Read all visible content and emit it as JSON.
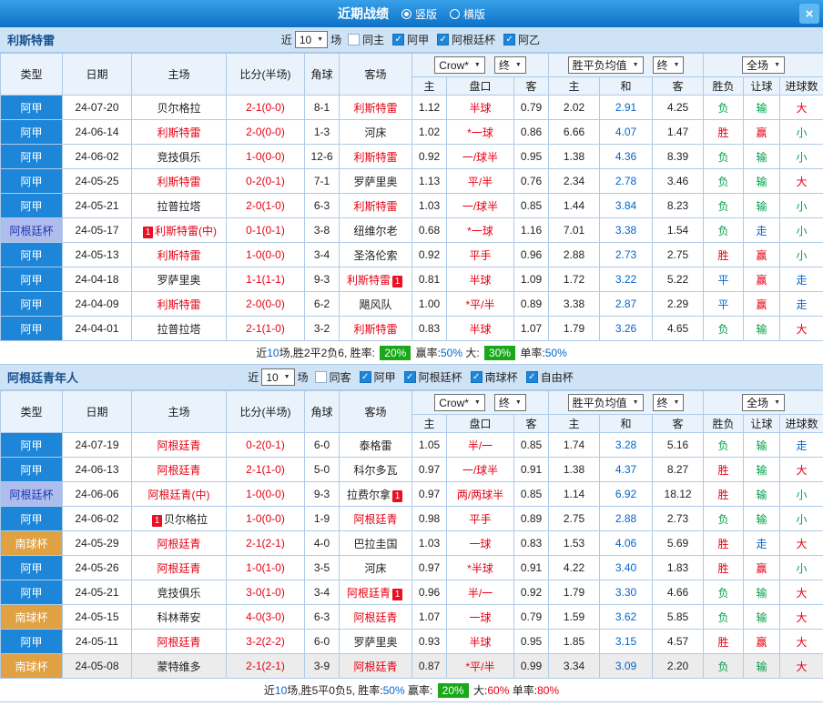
{
  "titlebar": {
    "title": "近期战绩",
    "radio_vertical": "竖版",
    "radio_horizontal": "横版",
    "close": "×"
  },
  "header_cols": {
    "col_type": "类型",
    "col_date": "日期",
    "col_home": "主场",
    "col_score": "比分(半场)",
    "col_corner": "角球",
    "col_away": "客场",
    "sel_bookmaker": "Crow*",
    "sel_final": "终",
    "sel_avg": "胜平负均值",
    "sel_scope": "全场",
    "sub_home": "主",
    "sub_handicap": "盘口",
    "sub_away": "客",
    "sub_home2": "主",
    "sub_draw": "和",
    "sub_away2": "客",
    "sub_result": "胜负",
    "sub_handicap_result": "让球",
    "sub_goals": "进球数"
  },
  "sections": [
    {
      "team": "利斯特雷",
      "filter": {
        "near": "近",
        "count": "10",
        "games": "场",
        "checks": [
          {
            "label": "同主",
            "checked": false
          },
          {
            "label": "阿甲",
            "checked": true
          },
          {
            "label": "阿根廷杯",
            "checked": true
          },
          {
            "label": "阿乙",
            "checked": true
          }
        ]
      },
      "rows": [
        {
          "lg": "阿甲",
          "lc": "aj",
          "date": "24-07-20",
          "home": "贝尔格拉",
          "homeRed": false,
          "score": "2-1(0-0)",
          "corner": "8-1",
          "away": "利斯特雷",
          "awayRed": true,
          "a1": "1.12",
          "hc": "半球",
          "a2": "0.79",
          "e1": "2.02",
          "e2": "2.91",
          "e3": "4.25",
          "r1": "负",
          "r2": "输",
          "r3": "大"
        },
        {
          "lg": "阿甲",
          "lc": "aj",
          "date": "24-06-14",
          "home": "利斯特雷",
          "homeRed": true,
          "score": "2-0(0-0)",
          "corner": "1-3",
          "away": "河床",
          "awayRed": false,
          "a1": "1.02",
          "hc": "*一球",
          "a2": "0.86",
          "e1": "6.66",
          "e2": "4.07",
          "e3": "1.47",
          "r1": "胜",
          "r2": "赢",
          "r3": "小"
        },
        {
          "lg": "阿甲",
          "lc": "aj",
          "date": "24-06-02",
          "home": "竞技俱乐",
          "homeRed": false,
          "score": "1-0(0-0)",
          "corner": "12-6",
          "away": "利斯特雷",
          "awayRed": true,
          "a1": "0.92",
          "hc": "一/球半",
          "a2": "0.95",
          "e1": "1.38",
          "e2": "4.36",
          "e3": "8.39",
          "r1": "负",
          "r2": "输",
          "r3": "小"
        },
        {
          "lg": "阿甲",
          "lc": "aj",
          "date": "24-05-25",
          "home": "利斯特雷",
          "homeRed": true,
          "score": "0-2(0-1)",
          "corner": "7-1",
          "away": "罗萨里奥",
          "awayRed": false,
          "a1": "1.13",
          "hc": "平/半",
          "a2": "0.76",
          "e1": "2.34",
          "e2": "2.78",
          "e3": "3.46",
          "r1": "负",
          "r2": "输",
          "r3": "大"
        },
        {
          "lg": "阿甲",
          "lc": "aj",
          "date": "24-05-21",
          "home": "拉普拉塔",
          "homeRed": false,
          "score": "2-0(1-0)",
          "corner": "6-3",
          "away": "利斯特雷",
          "awayRed": true,
          "a1": "1.03",
          "hc": "一/球半",
          "a2": "0.85",
          "e1": "1.44",
          "e2": "3.84",
          "e3": "8.23",
          "r1": "负",
          "r2": "输",
          "r3": "小"
        },
        {
          "lg": "阿根廷杯",
          "lc": "cup",
          "date": "24-05-17",
          "home": "利斯特雷(中)",
          "homeRed": true,
          "homePre": "1",
          "score": "0-1(0-1)",
          "corner": "3-8",
          "away": "纽维尔老",
          "awayRed": false,
          "a1": "0.68",
          "hc": "*一球",
          "a2": "1.16",
          "e1": "7.01",
          "e2": "3.38",
          "e3": "1.54",
          "r1": "负",
          "r2": "走",
          "r3": "小"
        },
        {
          "lg": "阿甲",
          "lc": "aj",
          "date": "24-05-13",
          "home": "利斯特雷",
          "homeRed": true,
          "score": "1-0(0-0)",
          "corner": "3-4",
          "away": "圣洛伦索",
          "awayRed": false,
          "a1": "0.92",
          "hc": "平手",
          "a2": "0.96",
          "e1": "2.88",
          "e2": "2.73",
          "e3": "2.75",
          "r1": "胜",
          "r2": "赢",
          "r3": "小"
        },
        {
          "lg": "阿甲",
          "lc": "aj",
          "date": "24-04-18",
          "home": "罗萨里奥",
          "homeRed": false,
          "score": "1-1(1-1)",
          "corner": "9-3",
          "away": "利斯特雷",
          "awayRed": true,
          "awayPost": "1",
          "a1": "0.81",
          "hc": "半球",
          "a2": "1.09",
          "e1": "1.72",
          "e2": "3.22",
          "e3": "5.22",
          "r1": "平",
          "r2": "赢",
          "r3": "走"
        },
        {
          "lg": "阿甲",
          "lc": "aj",
          "date": "24-04-09",
          "home": "利斯特雷",
          "homeRed": true,
          "score": "2-0(0-0)",
          "corner": "6-2",
          "away": "飓风队",
          "awayRed": false,
          "a1": "1.00",
          "hc": "*平/半",
          "a2": "0.89",
          "e1": "3.38",
          "e2": "2.87",
          "e3": "2.29",
          "r1": "平",
          "r2": "赢",
          "r3": "走"
        },
        {
          "lg": "阿甲",
          "lc": "aj",
          "date": "24-04-01",
          "home": "拉普拉塔",
          "homeRed": false,
          "score": "2-1(1-0)",
          "corner": "3-2",
          "away": "利斯特雷",
          "awayRed": true,
          "a1": "0.83",
          "hc": "半球",
          "a2": "1.07",
          "e1": "1.79",
          "e2": "3.26",
          "e3": "4.65",
          "r1": "负",
          "r2": "输",
          "r3": "大"
        }
      ],
      "summary": [
        {
          "s": "t",
          "x": "近"
        },
        {
          "s": "blue",
          "x": "10"
        },
        {
          "s": "t",
          "x": "场,胜2平2负6, 胜率: "
        },
        {
          "s": "badge",
          "x": "20%"
        },
        {
          "s": "t",
          "x": " 赢率:"
        },
        {
          "s": "blue",
          "x": "50%"
        },
        {
          "s": "t",
          "x": " 大: "
        },
        {
          "s": "badge",
          "x": "30%"
        },
        {
          "s": "t",
          "x": " 单率:"
        },
        {
          "s": "blue",
          "x": "50%"
        }
      ]
    },
    {
      "team": "阿根廷青年人",
      "filter": {
        "near": "近",
        "count": "10",
        "games": "场",
        "checks": [
          {
            "label": "同客",
            "checked": false
          },
          {
            "label": "阿甲",
            "checked": true
          },
          {
            "label": "阿根廷杯",
            "checked": true
          },
          {
            "label": "南球杯",
            "checked": true
          },
          {
            "label": "自由杯",
            "checked": true
          }
        ]
      },
      "rows": [
        {
          "lg": "阿甲",
          "lc": "aj",
          "date": "24-07-19",
          "home": "阿根廷青",
          "homeRed": true,
          "score": "0-2(0-1)",
          "corner": "6-0",
          "away": "泰格雷",
          "awayRed": false,
          "a1": "1.05",
          "hc": "半/一",
          "a2": "0.85",
          "e1": "1.74",
          "e2": "3.28",
          "e3": "5.16",
          "r1": "负",
          "r2": "输",
          "r3": "走"
        },
        {
          "lg": "阿甲",
          "lc": "aj",
          "date": "24-06-13",
          "home": "阿根廷青",
          "homeRed": true,
          "score": "2-1(1-0)",
          "corner": "5-0",
          "away": "科尔多瓦",
          "awayRed": false,
          "a1": "0.97",
          "hc": "一/球半",
          "a2": "0.91",
          "e1": "1.38",
          "e2": "4.37",
          "e3": "8.27",
          "r1": "胜",
          "r2": "输",
          "r3": "大"
        },
        {
          "lg": "阿根廷杯",
          "lc": "cup",
          "date": "24-06-06",
          "home": "阿根廷青(中)",
          "homeRed": true,
          "score": "1-0(0-0)",
          "corner": "9-3",
          "away": "拉费尔拿",
          "awayRed": false,
          "awayPost": "1",
          "a1": "0.97",
          "hc": "两/两球半",
          "a2": "0.85",
          "e1": "1.14",
          "e2": "6.92",
          "e3": "18.12",
          "r1": "胜",
          "r2": "输",
          "r3": "小"
        },
        {
          "lg": "阿甲",
          "lc": "aj",
          "date": "24-06-02",
          "home": "贝尔格拉",
          "homeRed": false,
          "homePre": "1",
          "score": "1-0(0-0)",
          "corner": "1-9",
          "away": "阿根廷青",
          "awayRed": true,
          "a1": "0.98",
          "hc": "平手",
          "a2": "0.89",
          "e1": "2.75",
          "e2": "2.88",
          "e3": "2.73",
          "r1": "负",
          "r2": "输",
          "r3": "小"
        },
        {
          "lg": "南球杯",
          "lc": "south",
          "date": "24-05-29",
          "home": "阿根廷青",
          "homeRed": true,
          "score": "2-1(2-1)",
          "corner": "4-0",
          "away": "巴拉圭国",
          "awayRed": false,
          "a1": "1.03",
          "hc": "一球",
          "a2": "0.83",
          "e1": "1.53",
          "e2": "4.06",
          "e3": "5.69",
          "r1": "胜",
          "r2": "走",
          "r3": "大"
        },
        {
          "lg": "阿甲",
          "lc": "aj",
          "date": "24-05-26",
          "home": "阿根廷青",
          "homeRed": true,
          "score": "1-0(1-0)",
          "corner": "3-5",
          "away": "河床",
          "awayRed": false,
          "a1": "0.97",
          "hc": "*半球",
          "a2": "0.91",
          "e1": "4.22",
          "e2": "3.40",
          "e3": "1.83",
          "r1": "胜",
          "r2": "赢",
          "r3": "小"
        },
        {
          "lg": "阿甲",
          "lc": "aj",
          "date": "24-05-21",
          "home": "竞技俱乐",
          "homeRed": false,
          "score": "3-0(1-0)",
          "corner": "3-4",
          "away": "阿根廷青",
          "awayRed": true,
          "awayPost": "1",
          "a1": "0.96",
          "hc": "半/一",
          "a2": "0.92",
          "e1": "1.79",
          "e2": "3.30",
          "e3": "4.66",
          "r1": "负",
          "r2": "输",
          "r3": "大"
        },
        {
          "lg": "南球杯",
          "lc": "south",
          "date": "24-05-15",
          "home": "科林蒂安",
          "homeRed": false,
          "score": "4-0(3-0)",
          "corner": "6-3",
          "away": "阿根廷青",
          "awayRed": true,
          "a1": "1.07",
          "hc": "一球",
          "a2": "0.79",
          "e1": "1.59",
          "e2": "3.62",
          "e3": "5.85",
          "r1": "负",
          "r2": "输",
          "r3": "大"
        },
        {
          "lg": "阿甲",
          "lc": "aj",
          "date": "24-05-11",
          "home": "阿根廷青",
          "homeRed": true,
          "score": "3-2(2-2)",
          "corner": "6-0",
          "away": "罗萨里奥",
          "awayRed": false,
          "a1": "0.93",
          "hc": "半球",
          "a2": "0.95",
          "e1": "1.85",
          "e2": "3.15",
          "e3": "4.57",
          "r1": "胜",
          "r2": "赢",
          "r3": "大"
        },
        {
          "lg": "南球杯",
          "lc": "south",
          "date": "24-05-08",
          "home": "蒙特维多",
          "homeRed": false,
          "score": "2-1(2-1)",
          "corner": "3-9",
          "away": "阿根廷青",
          "awayRed": true,
          "a1": "0.87",
          "hc": "*平/半",
          "a2": "0.99",
          "e1": "3.34",
          "e2": "3.09",
          "e3": "2.20",
          "r1": "负",
          "r2": "输",
          "r3": "大",
          "hl": true
        }
      ],
      "summary": [
        {
          "s": "t",
          "x": "近"
        },
        {
          "s": "blue",
          "x": "10"
        },
        {
          "s": "t",
          "x": "场,胜5平0负5, 胜率:"
        },
        {
          "s": "blue",
          "x": "50%"
        },
        {
          "s": "t",
          "x": " 赢率: "
        },
        {
          "s": "badge",
          "x": "20%"
        },
        {
          "s": "t",
          "x": " 大:"
        },
        {
          "s": "red",
          "x": "60%"
        },
        {
          "s": "t",
          "x": " 单率:"
        },
        {
          "s": "red",
          "x": "80%"
        }
      ]
    }
  ]
}
